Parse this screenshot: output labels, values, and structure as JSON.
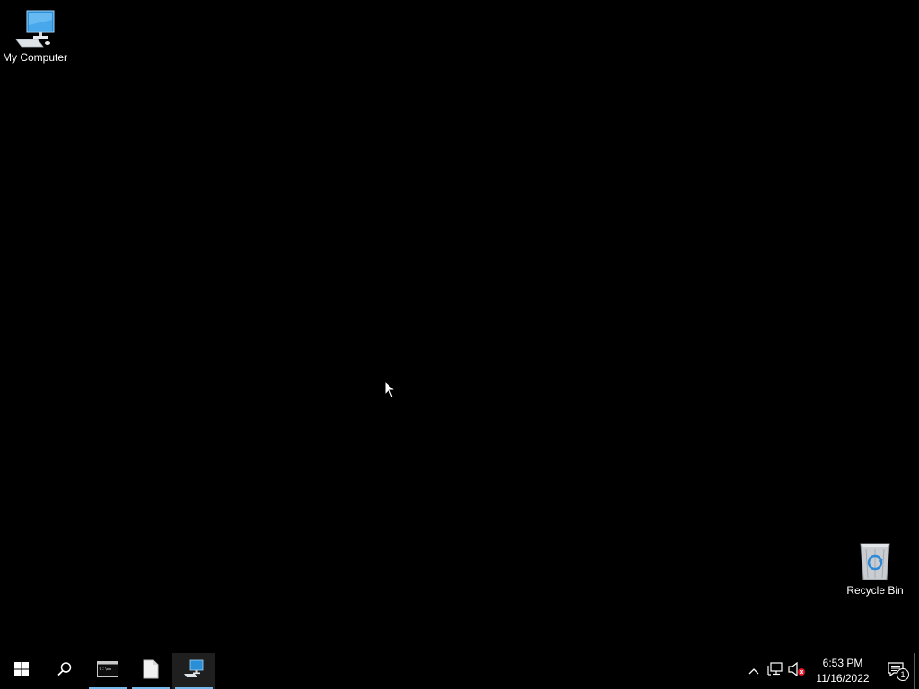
{
  "desktop": {
    "icons": [
      {
        "label": "My Computer",
        "icon": "computer-icon"
      },
      {
        "label": "Recycle Bin",
        "icon": "recycle-bin-icon"
      }
    ],
    "background_color": "#000000"
  },
  "taskbar": {
    "start": {
      "icon": "windows-start-icon"
    },
    "search": {
      "icon": "search-icon"
    },
    "apps": [
      {
        "icon": "command-prompt-icon",
        "running": true
      },
      {
        "icon": "document-icon",
        "running": true
      },
      {
        "icon": "computer-icon",
        "running": true
      }
    ],
    "accent_color": "#76b9ed",
    "tray": {
      "icons": [
        "chevron-up-icon",
        "network-icon",
        "volume-muted-icon"
      ],
      "time": "6:53 PM",
      "date": "11/16/2022",
      "notification_count": "1"
    }
  }
}
